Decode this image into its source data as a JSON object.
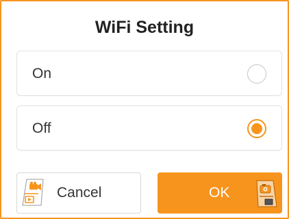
{
  "dialog": {
    "title": "WiFi Setting",
    "options": [
      {
        "label": "On",
        "selected": false
      },
      {
        "label": "Off",
        "selected": true
      }
    ],
    "buttons": {
      "cancel_label": "Cancel",
      "ok_label": "OK"
    },
    "icons": {
      "cancel": "video-camera-tag-icon",
      "ok": "camera-tag-icon"
    },
    "colors": {
      "accent": "#f7941d",
      "border": "#e3e3e3",
      "text": "#333333"
    }
  }
}
